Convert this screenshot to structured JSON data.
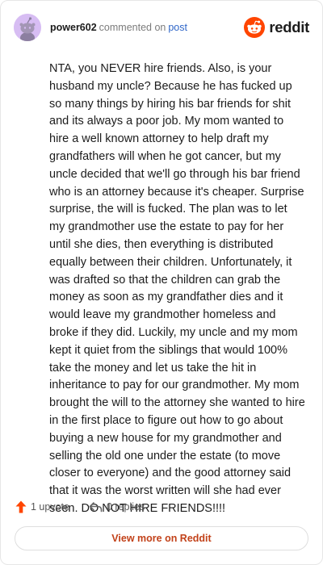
{
  "header": {
    "username": "power602",
    "action_text": "commented on",
    "post_link": "post",
    "brand_name": "reddit"
  },
  "comment": {
    "text": "NTA, you NEVER hire friends. Also, is your husband my uncle? Because he has fucked up so many things by hiring his bar friends for shit and its always a poor job. My mom wanted to hire a well known attorney to help draft my grandfathers will when he got cancer, but my uncle decided that we'll go through his bar friend who is an attorney because it's cheaper. Surprise surprise, the will is fucked. The plan was to let my grandmother use the estate to pay for her until she dies, then everything is distributed equally between their children. Unfortunately, it was drafted so that the children can grab the money as soon as my grandfather dies and it would leave my grandmother homeless and broke if they did. Luckily, my uncle and my mom kept it quiet from the siblings that would 100% take the money and let us take the hit in inheritance to pay for our grandmother. My mom brought the will to the attorney she wanted to hire in the first place to figure out how to go about buying a new house for my grandmother and selling the old one under the estate (to move closer to everyone) and the good attorney said that it was the worst written will she had ever seen. DO NOT HIRE FRIENDS!!!!"
  },
  "actions": {
    "upvote_label": "1 upvote",
    "replies_label": "0 replies"
  },
  "footer": {
    "view_more_label": "View more on Reddit"
  },
  "icons": {
    "avatar": "snoo-avatar",
    "brand": "reddit-logo-icon",
    "upvote": "upvote-arrow-icon",
    "reply": "reply-arrow-icon"
  },
  "colors": {
    "brand_orange": "#ff4500",
    "upvote_orange": "#ff4500",
    "avatar_bg": "#d7bdf3",
    "link_blue": "#2f66c8",
    "view_more_text": "#c2421a",
    "muted_text": "#7c7c7c"
  }
}
